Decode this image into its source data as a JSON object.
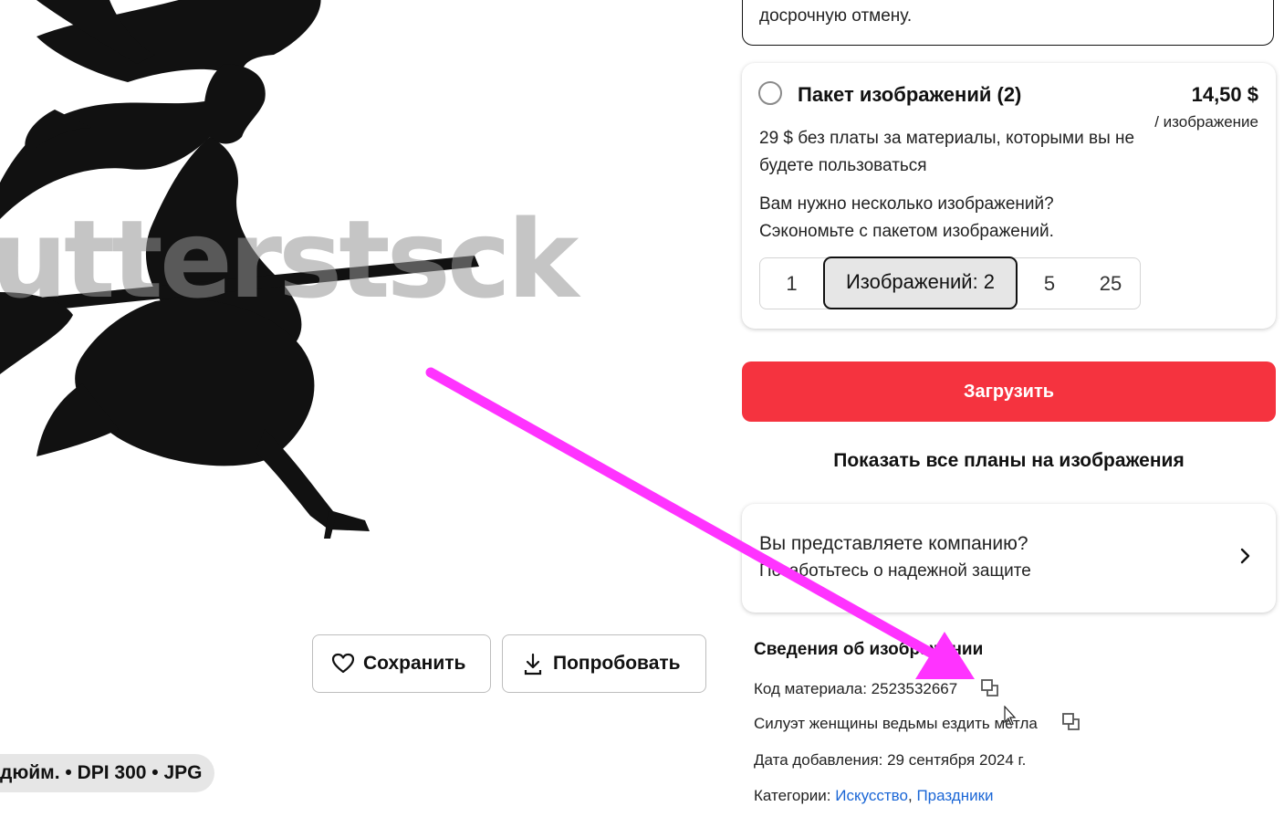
{
  "previous_plan": {
    "text_fragment": "досрочную отмену."
  },
  "image_pack": {
    "title": "Пакет изображений (2)",
    "price": "14,50 $",
    "price_unit": "/ изображение",
    "description": "29 $ без платы за материалы, которыми вы не будете пользоваться",
    "promo": "Вам нужно несколько изображений? Сэкономьте с пакетом изображений.",
    "quantities": [
      "1",
      "Изображений: 2",
      "5",
      "25"
    ],
    "selected_quantity": "Изображений: 2"
  },
  "download_button": "Загрузить",
  "show_all_plans": "Показать все планы на изображения",
  "company": {
    "question": "Вы представляете компанию?",
    "subtitle": "Позаботьтесь о надежной защите"
  },
  "details": {
    "title": "Сведения об изображении",
    "material_code_label": "Код материала: 2523532667",
    "description": "Силуэт женщины ведьмы ездить метла",
    "date_added": "Дата добавления: 29 сентября 2024 г.",
    "categories_label": "Категории:",
    "categories": [
      "Искусство",
      "Праздники"
    ],
    "category_separator": ", "
  },
  "actions": {
    "save": "Сохранить",
    "try": "Попробовать"
  },
  "image_meta": "дюйм. • DPI 300 • JPG",
  "watermark": "utterstsck",
  "colors": {
    "download_bg": "#f5333f",
    "link": "#1a66d6",
    "annotation_arrow": "#ff33ff"
  }
}
